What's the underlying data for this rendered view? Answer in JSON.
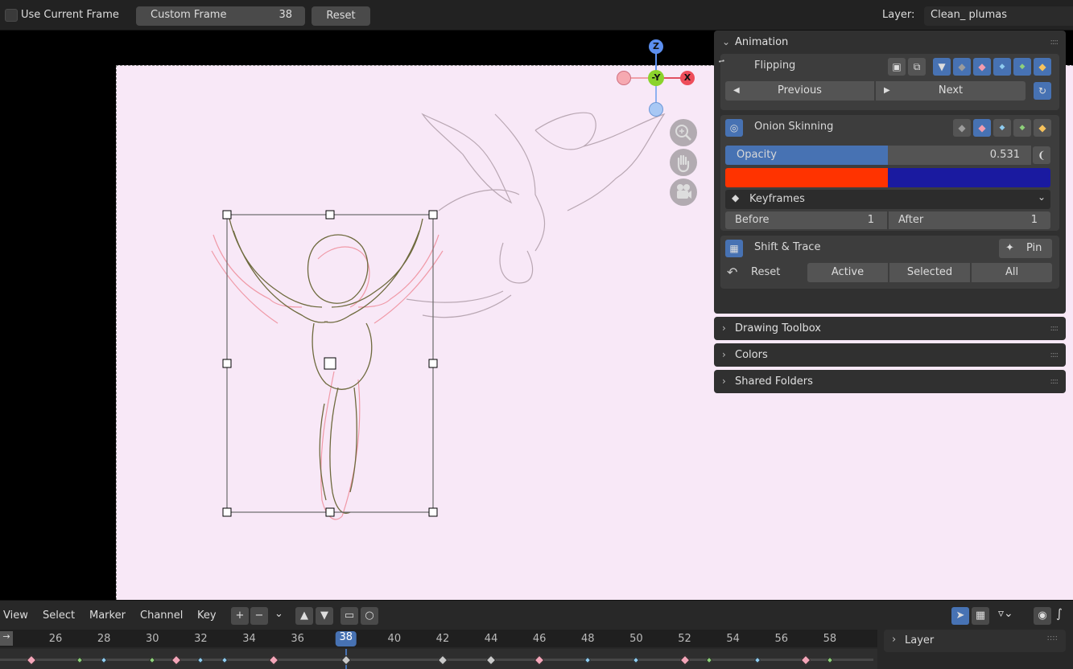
{
  "header": {
    "use_current_frame": "Use Current Frame",
    "custom_frame_label": "Custom Frame",
    "custom_frame_value": "38",
    "reset": "Reset",
    "layer_label": "Layer:",
    "layer_value": "Clean_ plumas"
  },
  "gizmo": {
    "z": "Z",
    "y": "-Y",
    "x": "X"
  },
  "icons": [
    "zoom-icon",
    "hand-icon",
    "camera-icon"
  ],
  "animation": {
    "title": "Animation",
    "flipping": "Flipping",
    "previous": "Previous",
    "next": "Next",
    "onion_skinning": "Onion Skinning",
    "opacity_label": "Opacity",
    "opacity_value": "0.531",
    "opacity_fraction": 0.531,
    "color_before": "#ff3300",
    "color_after": "#1a1aa0",
    "keyframes_mode": "Keyframes",
    "before_label": "Before",
    "before_value": "1",
    "after_label": "After",
    "after_value": "1",
    "shift_trace": "Shift & Trace",
    "pin": "Pin",
    "reset": "Reset",
    "active": "Active",
    "selected": "Selected",
    "all": "All"
  },
  "panels": {
    "drawing_toolbox": "Drawing Toolbox",
    "colors": "Colors",
    "shared_folders": "Shared Folders"
  },
  "timeline": {
    "menus": [
      "View",
      "Select",
      "Marker",
      "Channel",
      "Key"
    ],
    "frames": [
      "26",
      "28",
      "30",
      "32",
      "34",
      "36",
      "38",
      "40",
      "42",
      "44",
      "46",
      "48",
      "50",
      "52",
      "54",
      "56",
      "58"
    ],
    "current_frame": "38",
    "layer_panel": "Layer",
    "keyframes": [
      {
        "frame": 25.0,
        "type": "pink"
      },
      {
        "frame": 27.0,
        "type": "green"
      },
      {
        "frame": 28.0,
        "type": "blue"
      },
      {
        "frame": 30.0,
        "type": "green"
      },
      {
        "frame": 31.0,
        "type": "pink"
      },
      {
        "frame": 32.0,
        "type": "blue"
      },
      {
        "frame": 33.0,
        "type": "blue"
      },
      {
        "frame": 35.0,
        "type": "pink"
      },
      {
        "frame": 38.0,
        "type": "gray"
      },
      {
        "frame": 42.0,
        "type": "gray"
      },
      {
        "frame": 44.0,
        "type": "gray"
      },
      {
        "frame": 46.0,
        "type": "pink"
      },
      {
        "frame": 48.0,
        "type": "blue"
      },
      {
        "frame": 50.0,
        "type": "blue"
      },
      {
        "frame": 52.0,
        "type": "pink"
      },
      {
        "frame": 53.0,
        "type": "green"
      },
      {
        "frame": 55.0,
        "type": "blue"
      },
      {
        "frame": 57.0,
        "type": "pink"
      },
      {
        "frame": 58.0,
        "type": "green"
      }
    ]
  },
  "colors": {
    "accent": "#4772b3",
    "pink_key": "#f3a5b8",
    "green_key": "#8ed07a",
    "blue_key": "#8ecbef",
    "gray_key": "#c8c8c8"
  }
}
